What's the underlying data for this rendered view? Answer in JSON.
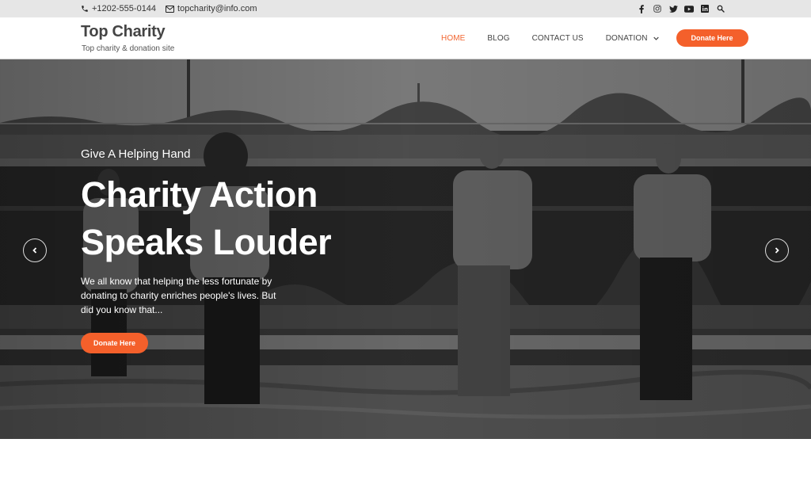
{
  "topbar": {
    "phone": "+1202-555-0144",
    "email": "topcharity@info.com",
    "social": [
      "facebook-icon",
      "instagram-icon",
      "twitter-icon",
      "youtube-icon",
      "linkedin-icon",
      "search-icon"
    ]
  },
  "header": {
    "site_title": "Top Charity",
    "tagline": "Top charity & donation site"
  },
  "nav": {
    "items": [
      {
        "label": "HOME",
        "active": true
      },
      {
        "label": "BLOG"
      },
      {
        "label": "CONTACT US"
      },
      {
        "label": "DONATION",
        "has_dropdown": true
      }
    ],
    "cta_label": "Donate Here"
  },
  "hero": {
    "eyebrow": "Give A Helping Hand",
    "headline_line1": "Charity Action",
    "headline_line2": "Speaks Louder",
    "description": "We all know that helping the less fortunate by donating to charity enriches people's lives. But did you know that...",
    "cta_label": "Donate Here",
    "image_alt": "Volunteers running on a field (grayscale photo)"
  },
  "colors": {
    "accent": "#f4602b",
    "topbar_bg": "#e6e6e6",
    "text_dark": "#444444"
  }
}
